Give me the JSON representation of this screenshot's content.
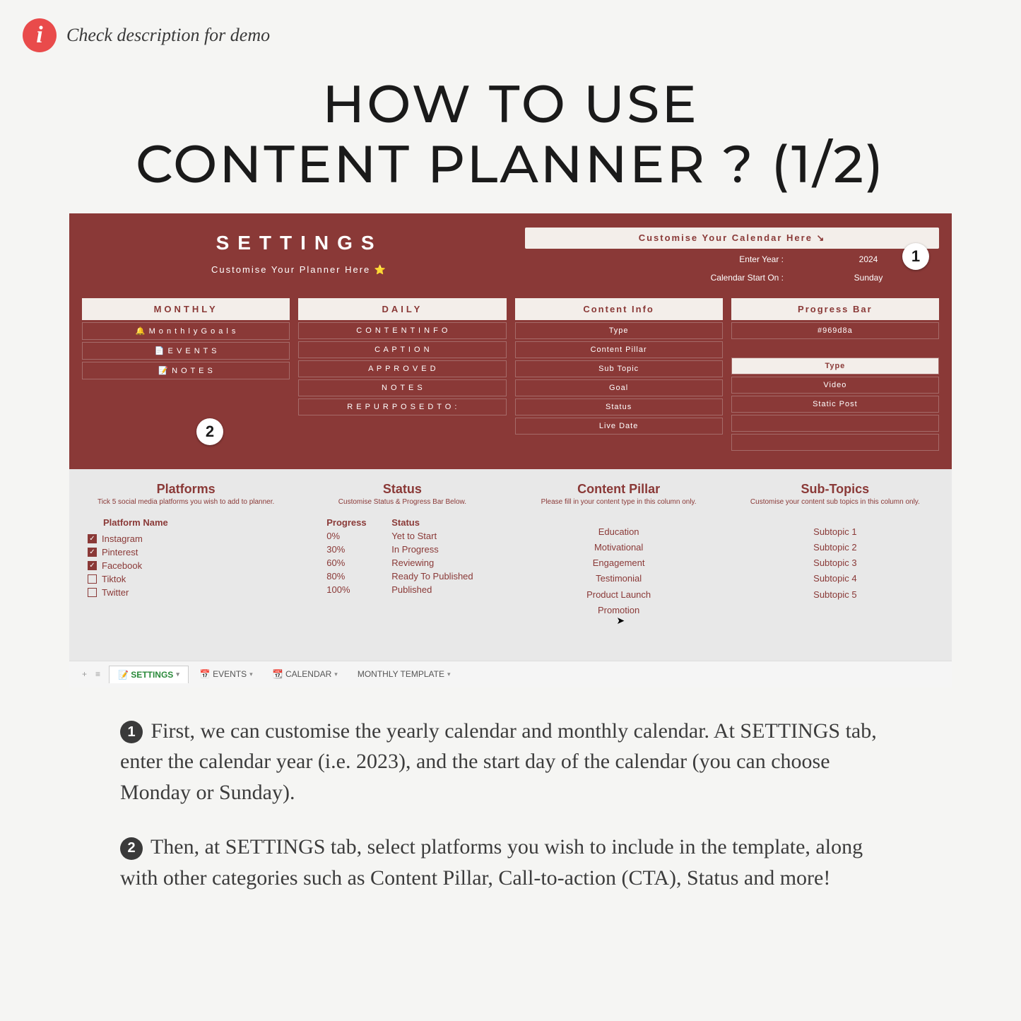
{
  "banner": {
    "info_glyph": "i",
    "text": "Check description for demo"
  },
  "title_line1": "HOW TO USE",
  "title_line2": "CONTENT PLANNER ?   (1/2)",
  "settings": {
    "title": "SETTINGS",
    "subtitle": "Customise Your Planner Here ⭐",
    "customise": {
      "header": "Customise Your Calendar Here ↘",
      "year_label": "Enter Year :",
      "year_value": "2024",
      "start_label": "Calendar Start On :",
      "start_value": "Sunday"
    },
    "cols": {
      "monthly": {
        "head": "MONTHLY",
        "cells": [
          "🔔 M o n t h l y  G o a l s",
          "📄 E V E N T S",
          "📝 N O T E S"
        ]
      },
      "daily": {
        "head": "DAILY",
        "cells": [
          "C O N T E N T  I N F O",
          "C A P T I O N",
          "A P P R O V E D",
          "N O T E S",
          "R E P U R P O S E D  T O :"
        ]
      },
      "content": {
        "head": "Content Info",
        "cells": [
          "Type",
          "Content Pillar",
          "Sub Topic",
          "Goal",
          "Status",
          "Live Date"
        ]
      },
      "progress": {
        "head": "Progress Bar",
        "color": "#969d8a",
        "type_head": "Type",
        "cells": [
          "Video",
          "Static Post"
        ]
      }
    },
    "badges": {
      "one": "1",
      "two": "2"
    }
  },
  "bottom": {
    "platforms": {
      "title": "Platforms",
      "sub": "Tick 5 social media platforms you wish to add to planner.",
      "header": "Platform Name",
      "items": [
        {
          "name": "Instagram",
          "checked": true
        },
        {
          "name": "Pinterest",
          "checked": true
        },
        {
          "name": "Facebook",
          "checked": true
        },
        {
          "name": "Tiktok",
          "checked": false
        },
        {
          "name": "Twitter",
          "checked": false
        }
      ]
    },
    "status": {
      "title": "Status",
      "sub": "Customise Status & Progress Bar Below.",
      "h1": "Progress",
      "h2": "Status",
      "rows": [
        {
          "p": "0%",
          "s": "Yet to Start"
        },
        {
          "p": "30%",
          "s": "In Progress"
        },
        {
          "p": "60%",
          "s": "Reviewing"
        },
        {
          "p": "80%",
          "s": "Ready To Published"
        },
        {
          "p": "100%",
          "s": "Published"
        }
      ]
    },
    "pillar": {
      "title": "Content Pillar",
      "sub": "Please fill in your content type in this column only.",
      "items": [
        "Education",
        "Motivational",
        "Engagement",
        "Testimonial",
        "Product Launch",
        "Promotion"
      ]
    },
    "subtopics": {
      "title": "Sub-Topics",
      "sub": "Customise your content sub topics in this column only.",
      "items": [
        "Subtopic 1",
        "Subtopic 2",
        "Subtopic 3",
        "Subtopic 4",
        "Subtopic 5"
      ]
    }
  },
  "tabs": {
    "add": "+",
    "menu": "≡",
    "items": [
      {
        "icon": "📝",
        "label": "SETTINGS",
        "active": true
      },
      {
        "icon": "📅",
        "label": "EVENTS",
        "active": false
      },
      {
        "icon": "📆",
        "label": "CALENDAR",
        "active": false
      },
      {
        "icon": "",
        "label": "MONTHLY TEMPLATE",
        "active": false
      }
    ]
  },
  "instructions": {
    "one_num": "1",
    "one_text": "First, we can customise the yearly calendar and monthly calendar. At SETTINGS tab, enter the calendar year (i.e. 2023), and the start day of the calendar (you can choose Monday or Sunday).",
    "two_num": "2",
    "two_text": "Then, at SETTINGS tab, select platforms you wish to include in the template, along with other categories such as Content Pillar, Call-to-action (CTA), Status and more!"
  }
}
